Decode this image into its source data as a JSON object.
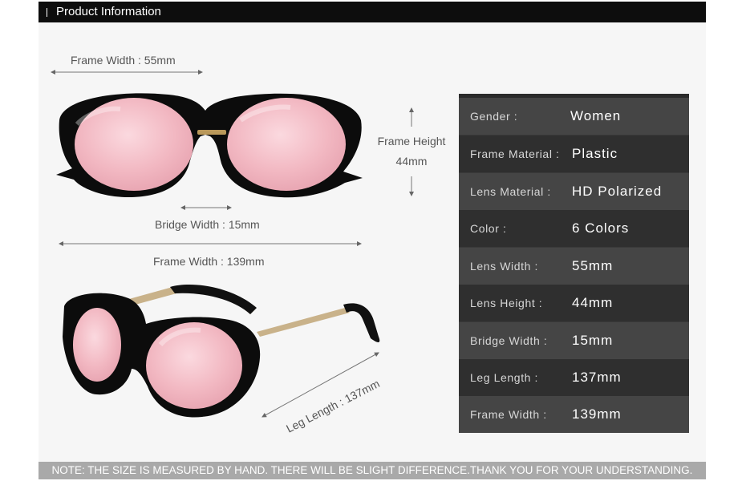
{
  "header": {
    "title": "Product Information"
  },
  "dimensions": {
    "frame_width_lens": "Frame Width : 55mm",
    "frame_height_title": "Frame Height",
    "frame_height_value": "44mm",
    "bridge_width": "Bridge Width : 15mm",
    "frame_width_total": "Frame Width : 139mm",
    "leg_length": "Leg Length : 137mm"
  },
  "specs": [
    {
      "key": "Gender :",
      "value": "Women"
    },
    {
      "key": "Frame Material :",
      "value": "Plastic"
    },
    {
      "key": "Lens Material :",
      "value": "HD Polarized"
    },
    {
      "key": "Color :",
      "value": "6 Colors"
    },
    {
      "key": "Lens Width :",
      "value": "55mm"
    },
    {
      "key": "Lens Height :",
      "value": "44mm"
    },
    {
      "key": "Bridge Width :",
      "value": "15mm"
    },
    {
      "key": "Leg Length :",
      "value": "137mm"
    },
    {
      "key": "Frame Width :",
      "value": "139mm"
    }
  ],
  "note": "NOTE: THE SIZE IS MEASURED BY HAND. THERE WILL BE SLIGHT DIFFERENCE.THANK YOU FOR YOUR UNDERSTANDING.",
  "colors": {
    "header_bg": "#0d0d0d",
    "lens_pink": "#f2b8c2",
    "frame_black": "#111111",
    "table_bg": "#3a3a3a"
  }
}
